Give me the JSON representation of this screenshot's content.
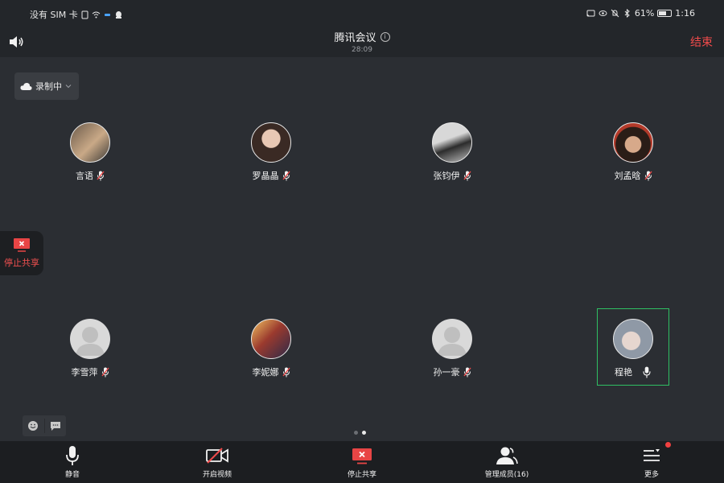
{
  "status_bar": {
    "carrier": "没有 SIM 卡",
    "battery": "61%",
    "battery_level": 0.61,
    "time": "1:16"
  },
  "header": {
    "title": "腾讯会议",
    "timer": "28:09",
    "end_label": "结束"
  },
  "recording": {
    "label": "录制中"
  },
  "participants": [
    {
      "name": "言语",
      "avatar": "photo"
    },
    {
      "name": "罗晶晶",
      "avatar": "photo"
    },
    {
      "name": "张钧伊",
      "avatar": "photo"
    },
    {
      "name": "刘孟晗",
      "avatar": "photo"
    },
    {
      "name": "李雪萍",
      "avatar": "placeholder"
    },
    {
      "name": "李妮娜",
      "avatar": "photo"
    },
    {
      "name": "孙一豪",
      "avatar": "placeholder"
    },
    {
      "name": "程艳",
      "avatar": "photo",
      "active_speaker": true
    }
  ],
  "floating_share": {
    "label": "停止共享"
  },
  "toolbar": {
    "mute": "静音",
    "video": "开启视频",
    "share": "停止共享",
    "members": "管理成员(16)",
    "more": "更多"
  },
  "pager": {
    "pages": 2,
    "current": 2
  },
  "colors": {
    "background": "#2b2e33",
    "end_red": "#f04b4b",
    "active_green": "#2fbf63",
    "share_red": "#e84545"
  }
}
